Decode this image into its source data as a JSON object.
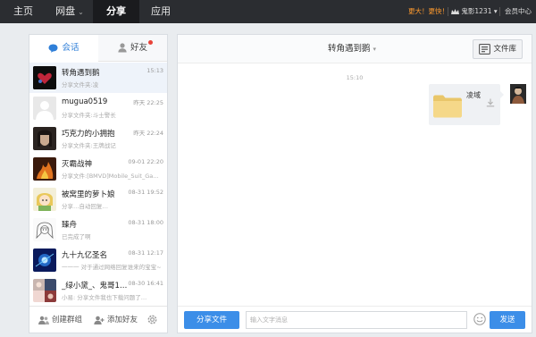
{
  "nav": {
    "items": [
      {
        "label": "主页",
        "active": false,
        "has_caret": false
      },
      {
        "label": "网盘",
        "active": false,
        "has_caret": true
      },
      {
        "label": "分享",
        "active": true,
        "has_caret": false
      },
      {
        "label": "应用",
        "active": false,
        "has_caret": false
      }
    ],
    "promo": "更大！更快！",
    "user_name": "鬼影1231",
    "user_caret": "▾",
    "vip_center": "会员中心"
  },
  "left": {
    "tabs": [
      {
        "label": "会话",
        "icon": "chat-bubble-icon",
        "active": true
      },
      {
        "label": "好友",
        "icon": "person-icon",
        "active": false,
        "badge": true
      }
    ],
    "conversations": [
      {
        "name": "转角遇到鹅",
        "time": "15:13",
        "preview": "分享文件夹:凌",
        "avatar": "dark-heart",
        "selected": true
      },
      {
        "name": "mugua0519",
        "time": "昨天 22:25",
        "preview": "分享文件夹:斗士警长",
        "avatar": "default"
      },
      {
        "name": "巧克力的小拥抱",
        "time": "昨天 22:24",
        "preview": "分享文件夹:王牌战记",
        "avatar": "girl-dark"
      },
      {
        "name": "灭霸战神",
        "time": "09-01 22:20",
        "preview": "分享文件:[BMVD]Mobile_Suit_Ga...",
        "avatar": "fire"
      },
      {
        "name": "被窝里的萝卜娘",
        "time": "08-31 19:52",
        "preview": "分享…自动回复…",
        "avatar": "anime-yellow"
      },
      {
        "name": "臻舟",
        "time": "08-31 18:00",
        "preview": "已完成了啊",
        "avatar": "anime-sketch"
      },
      {
        "name": "九十九亿圣名",
        "time": "08-31 12:17",
        "preview": "一一一 对于通过网络回复谁来的宝宝~",
        "avatar": "blue-glow"
      },
      {
        "name": "_绿小黛_、鬼哥1…",
        "time": "08-30 16:41",
        "preview": "小易: 分享文件我也下载问题了…",
        "avatar": "group"
      }
    ],
    "footer": {
      "create_group": "创建群组",
      "add_friend": "添加好友"
    }
  },
  "chat": {
    "title": "转角遇到鹅",
    "title_caret": "▾",
    "library_label": "文件库",
    "message_time": "15:10",
    "message": {
      "file_name": "凌域",
      "type": "folder"
    },
    "share_file_label": "分享文件",
    "input_placeholder": "输入文字消息",
    "send_label": "发送"
  },
  "colors": {
    "topbar": "#2b2d31",
    "accent": "#3c8ee8",
    "promo": "#ff9a2e",
    "badge": "#e8433a"
  }
}
